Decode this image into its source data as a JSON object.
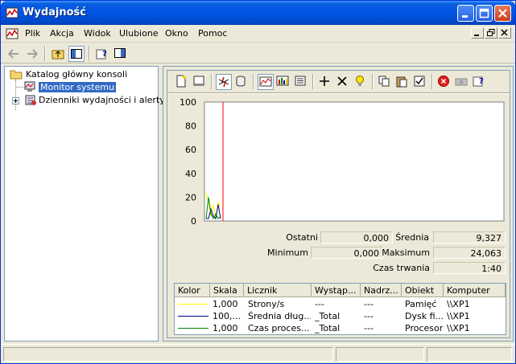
{
  "window": {
    "title": "Wydajność"
  },
  "menu": {
    "items": [
      "Plik",
      "Akcja",
      "Widok",
      "Ulubione",
      "Okno",
      "Pomoc"
    ]
  },
  "tree": {
    "root": "Katalog główny konsoli",
    "items": [
      {
        "label": "Monitor systemu",
        "selected": true
      },
      {
        "label": "Dzienniki wydajności i alerty",
        "selected": false
      }
    ]
  },
  "chart_data": {
    "type": "line",
    "ylim": [
      0,
      100
    ],
    "y_ticks": [
      "100",
      "80",
      "60",
      "40",
      "20",
      "0"
    ],
    "grid": false,
    "series": [
      {
        "color": "#ffff00",
        "values": [
          24,
          16,
          4,
          14,
          2,
          16,
          12
        ]
      },
      {
        "color": "#000080",
        "values": [
          2,
          2,
          10,
          4,
          2,
          14,
          2
        ]
      },
      {
        "color": "#008000",
        "values": [
          2,
          20,
          6,
          2,
          6,
          2,
          4
        ]
      }
    ],
    "cursor_color": "#ff0000"
  },
  "stats": {
    "last_label": "Ostatni",
    "last_value": "0,000",
    "avg_label": "Średnia",
    "avg_value": "9,327",
    "min_label": "Minimum",
    "min_value": "0,000",
    "max_label": "Maksimum",
    "max_value": "24,063",
    "duration_label": "Czas trwania",
    "duration_value": "1:40"
  },
  "legend": {
    "headers": [
      "Kolor",
      "Skala",
      "Licznik",
      "Wystąp...",
      "Nadrz...",
      "Obiekt",
      "Komputer"
    ],
    "rows": [
      {
        "color": "#ffff00",
        "scale": "1,000",
        "counter": "Strony/s",
        "instance": "---",
        "parent": "---",
        "object": "Pamięć",
        "computer": "\\\\XP1"
      },
      {
        "color": "#000080",
        "scale": "100,...",
        "counter": "Średnia dług...",
        "instance": "_Total",
        "parent": "---",
        "object": "Dysk fi...",
        "computer": "\\\\XP1"
      },
      {
        "color": "#008000",
        "scale": "1,000",
        "counter": "Czas proces...",
        "instance": "_Total",
        "parent": "---",
        "object": "Procesor",
        "computer": "\\\\XP1"
      }
    ]
  },
  "colors": {
    "titlebar": "#0054e3",
    "selection": "#316ac5",
    "chrome": "#ece9d8"
  }
}
